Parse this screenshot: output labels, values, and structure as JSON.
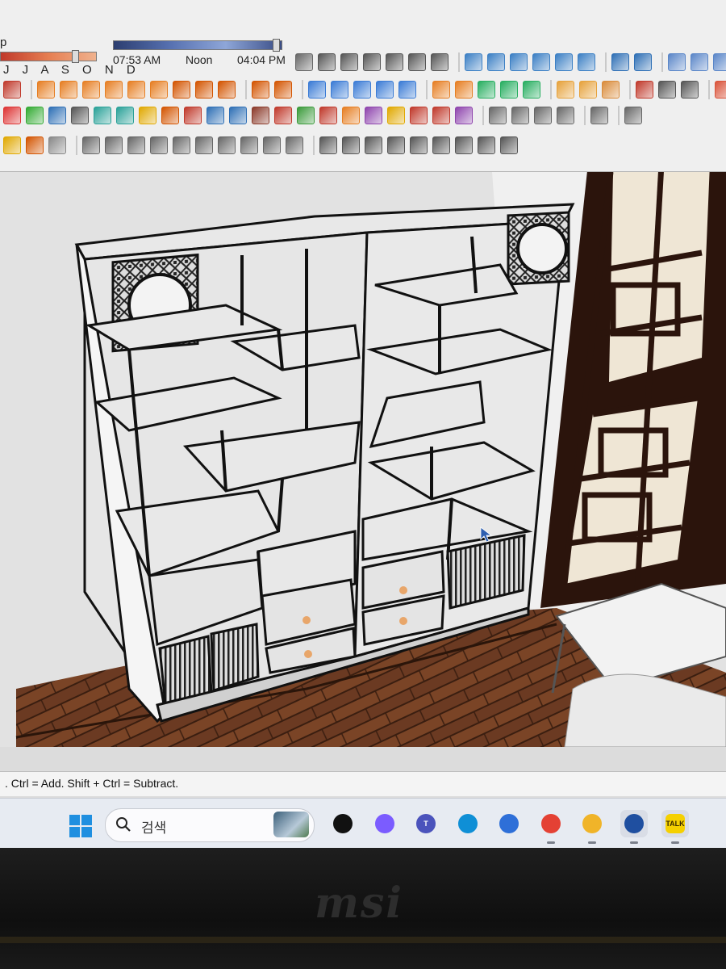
{
  "toolbar": {
    "title_fragment": "p",
    "shadow_months": "J J A S O N D",
    "time_start": "07:53 AM",
    "time_mid": "Noon",
    "time_end": "04:04 PM",
    "rows": [
      {
        "icons": [
          {
            "name": "cube-outline-icon",
            "color": "#666"
          },
          {
            "name": "component-icon",
            "color": "#555"
          },
          {
            "name": "box-icon",
            "color": "#555"
          },
          {
            "name": "door-icon",
            "color": "#555"
          },
          {
            "name": "table-icon",
            "color": "#555"
          },
          {
            "name": "house-icon",
            "color": "#555"
          },
          {
            "name": "square-icon",
            "color": "#555"
          },
          {
            "name": "sep"
          },
          {
            "name": "align-icon",
            "color": "#3b7fc4"
          },
          {
            "name": "align-left-icon",
            "color": "#3b7fc4"
          },
          {
            "name": "align-right-icon",
            "color": "#3b7fc4"
          },
          {
            "name": "align-top-icon",
            "color": "#3b7fc4"
          },
          {
            "name": "align-bottom-icon",
            "color": "#3b7fc4"
          },
          {
            "name": "distribute-icon",
            "color": "#3b7fc4"
          },
          {
            "name": "sep"
          },
          {
            "name": "globe-icon",
            "color": "#2e6fb5"
          },
          {
            "name": "grid-icon",
            "color": "#2e6fb5"
          },
          {
            "name": "sep"
          },
          {
            "name": "transform-icon",
            "color": "#5a86c8"
          },
          {
            "name": "rotate-icon",
            "color": "#5a86c8"
          },
          {
            "name": "flip-icon",
            "color": "#5a86c8"
          },
          {
            "name": "mirror-icon",
            "color": "#5a86c8"
          },
          {
            "name": "skew-icon",
            "color": "#5a86c8"
          },
          {
            "name": "sep"
          },
          {
            "name": "target-icon",
            "color": "#888"
          },
          {
            "name": "solid-blue-icon",
            "color": "#4a7ac4"
          },
          {
            "name": "solid-dark-icon",
            "color": "#3c5c9a"
          },
          {
            "name": "solid-navy-icon",
            "color": "#2e4c88"
          },
          {
            "name": "sep"
          },
          {
            "name": "house-red-icon",
            "color": "#b44a2a"
          }
        ]
      },
      {
        "icons": [
          {
            "name": "shape-icon",
            "color": "#c0392b"
          },
          {
            "name": "sep"
          },
          {
            "name": "pencil-icon",
            "color": "#e67e22"
          },
          {
            "name": "rect-icon",
            "color": "#e67e22"
          },
          {
            "name": "circle-icon",
            "color": "#e67e22"
          },
          {
            "name": "polygon-icon",
            "color": "#e67e22"
          },
          {
            "name": "arc-icon",
            "color": "#e67e22"
          },
          {
            "name": "box-tool-icon",
            "color": "#e67e22"
          },
          {
            "name": "push-pull-icon",
            "color": "#d35400"
          },
          {
            "name": "follow-me-icon",
            "color": "#d35400"
          },
          {
            "name": "offset-icon",
            "color": "#d35400"
          },
          {
            "name": "sep"
          },
          {
            "name": "move-icon",
            "color": "#d35400"
          },
          {
            "name": "scale-icon",
            "color": "#d35400"
          },
          {
            "name": "sep"
          },
          {
            "name": "paint-icon",
            "color": "#3a7bd5"
          },
          {
            "name": "eraser-icon",
            "color": "#3a7bd5"
          },
          {
            "name": "tape-icon",
            "color": "#3a7bd5"
          },
          {
            "name": "protractor-icon",
            "color": "#3a7bd5"
          },
          {
            "name": "section-icon",
            "color": "#3a7bd5"
          },
          {
            "name": "sep"
          },
          {
            "name": "solid-union-icon",
            "color": "#e67e22"
          },
          {
            "name": "solid-subtract-icon",
            "color": "#e67e22"
          },
          {
            "name": "solid-split-icon",
            "color": "#27ae60"
          },
          {
            "name": "solid-trim-icon",
            "color": "#27ae60"
          },
          {
            "name": "solid-intersect-icon",
            "color": "#27ae60"
          },
          {
            "name": "sep"
          },
          {
            "name": "grid-orange-icon",
            "color": "#e6a23c"
          },
          {
            "name": "grid-yellow-icon",
            "color": "#e6a23c"
          },
          {
            "name": "grid-tan-icon",
            "color": "#d98b3a"
          },
          {
            "name": "sep"
          },
          {
            "name": "dots-icon",
            "color": "#c0392b"
          },
          {
            "name": "curve-icon",
            "color": "#555"
          },
          {
            "name": "qr-icon",
            "color": "#555"
          },
          {
            "name": "sep"
          },
          {
            "name": "cube-red-icon",
            "color": "#d9533a"
          }
        ]
      },
      {
        "icons": [
          {
            "name": "plus-red-icon",
            "color": "#d33"
          },
          {
            "name": "plus-green-icon",
            "color": "#3a3"
          },
          {
            "name": "cross-blue-icon",
            "color": "#2e6fb5"
          },
          {
            "name": "points-icon",
            "color": "#555"
          },
          {
            "name": "cone-icon",
            "color": "#2aa198"
          },
          {
            "name": "tree-icon",
            "color": "#2aa198"
          },
          {
            "name": "warning-icon",
            "color": "#e0a800"
          },
          {
            "name": "rotate-orange-icon",
            "color": "#d35400"
          },
          {
            "name": "rotate-red-icon",
            "color": "#c0392b"
          },
          {
            "name": "rotate-blue-icon",
            "color": "#2e6fb5"
          },
          {
            "name": "move-arrows-icon",
            "color": "#2e6fb5"
          },
          {
            "name": "box-brown-icon",
            "color": "#8b3a2a"
          },
          {
            "name": "magnet-icon",
            "color": "#c0392b"
          },
          {
            "name": "leaf-icon",
            "color": "#3a9a3a"
          },
          {
            "name": "scale-red-icon",
            "color": "#c0392b"
          },
          {
            "name": "scale-orange-icon",
            "color": "#e67e22"
          },
          {
            "name": "scale-purple-icon",
            "color": "#8e44ad"
          },
          {
            "name": "scale-yellow-icon",
            "color": "#e0a800"
          },
          {
            "name": "bend-icon",
            "color": "#c0392b"
          },
          {
            "name": "twist-icon",
            "color": "#c0392b"
          },
          {
            "name": "taper-icon",
            "color": "#8e44ad"
          },
          {
            "name": "sep"
          },
          {
            "name": "cube-small-icon",
            "color": "#666"
          },
          {
            "name": "cube-grid-icon",
            "color": "#666"
          },
          {
            "name": "sphere-icon",
            "color": "#666"
          },
          {
            "name": "ring-icon",
            "color": "#666"
          },
          {
            "name": "sep"
          },
          {
            "name": "hand-icon",
            "color": "#666"
          },
          {
            "name": "sep"
          },
          {
            "name": "orbit-icon",
            "color": "#666"
          }
        ]
      },
      {
        "icons": [
          {
            "name": "sun-icon",
            "color": "#e0a800"
          },
          {
            "name": "dome-icon",
            "color": "#d35400"
          },
          {
            "name": "cube-light-icon",
            "color": "#888"
          },
          {
            "name": "sep"
          },
          {
            "name": "iron-icon",
            "color": "#666"
          },
          {
            "name": "cube-wire-icon",
            "color": "#666"
          },
          {
            "name": "cube-solid-icon",
            "color": "#666"
          },
          {
            "name": "wave-icon",
            "color": "#666"
          },
          {
            "name": "tag-icon",
            "color": "#666"
          },
          {
            "name": "panel-icon",
            "color": "#666"
          },
          {
            "name": "edit-icon",
            "color": "#666"
          },
          {
            "name": "table-grid-icon",
            "color": "#666"
          },
          {
            "name": "eye-icon",
            "color": "#666"
          },
          {
            "name": "layers-icon",
            "color": "#666"
          },
          {
            "name": "sep"
          },
          {
            "name": "bowl-icon",
            "color": "#555"
          },
          {
            "name": "checker-icon",
            "color": "#555"
          },
          {
            "name": "diag-icon",
            "color": "#555"
          },
          {
            "name": "texture-icon",
            "color": "#555"
          },
          {
            "name": "texture-box-icon",
            "color": "#555"
          },
          {
            "name": "texture-cube-icon",
            "color": "#555"
          },
          {
            "name": "sphere-map-icon",
            "color": "#555"
          },
          {
            "name": "globe-map-icon",
            "color": "#555"
          },
          {
            "name": "cube-uv-icon",
            "color": "#555"
          }
        ]
      }
    ]
  },
  "statusbar": {
    "text": ". Ctrl = Add. Shift + Ctrl = Subtract."
  },
  "taskbar": {
    "search_label": "검색",
    "apps": [
      {
        "name": "terminal-app",
        "label": "",
        "color": "#111"
      },
      {
        "name": "copilot-app",
        "label": "",
        "color": "#7b5cff"
      },
      {
        "name": "teams-app",
        "label": "T",
        "color": "#4b53bc"
      },
      {
        "name": "edge-app",
        "label": "",
        "color": "#0f8fd6"
      },
      {
        "name": "store-app",
        "label": "",
        "color": "#2e6fd8"
      },
      {
        "name": "chrome-app",
        "label": "",
        "color": "#e44134"
      },
      {
        "name": "file-explorer-app",
        "label": "",
        "color": "#f0b429"
      },
      {
        "name": "sketchup-app",
        "label": "",
        "color": "#1f4fa0"
      },
      {
        "name": "kakaotalk-app",
        "label": "TALK",
        "color": "#f5d000"
      }
    ]
  },
  "bezel": {
    "logo": "msi"
  },
  "colors": {
    "floor": "#6b3a22",
    "lattice": "#2b140c",
    "shelf_fill": "#e8e8e8",
    "shelf_edge": "#1a1a1a"
  }
}
